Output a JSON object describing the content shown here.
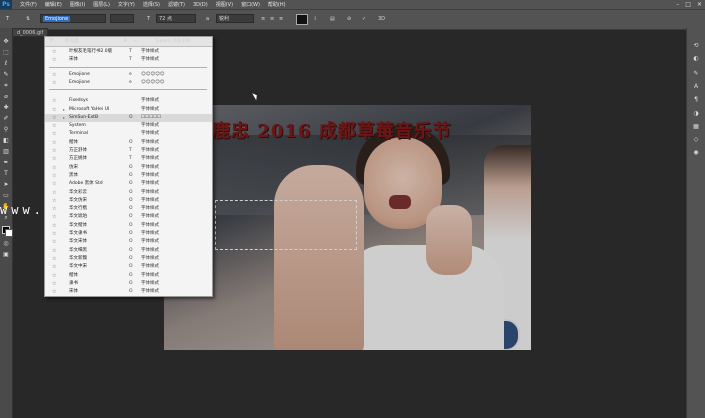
{
  "menubar": {
    "logo": "Ps",
    "items": [
      "文件(F)",
      "编辑(E)",
      "图像(I)",
      "图层(L)",
      "文字(Y)",
      "选择(S)",
      "滤镜(T)",
      "3D(D)",
      "视图(V)",
      "窗口(W)",
      "帮助(H)"
    ]
  },
  "options": {
    "font_family_value": "Emojione",
    "font_size_value": "72 点",
    "antialias_value": "锐利",
    "color_swatch": "#111111"
  },
  "document_tab": "d_0006.gif",
  "font_menu": {
    "filter_label": "所有类",
    "header_label": "Typekit 添加字体",
    "rows": [
      {
        "name": "叶根友毛笔行书2.0版",
        "type": "T",
        "sample": "字体样式"
      },
      {
        "name": "宋体",
        "type": "T",
        "sample": "字体样式"
      },
      {
        "name": "Emojione",
        "type": "e",
        "sample": "☺☺☺☺☺"
      },
      {
        "name": "Emojione",
        "type": "e",
        "sample": "☺☺☺☺☺"
      },
      {
        "name": "Fixedsys",
        "type": "",
        "sample": "字体样式"
      },
      {
        "name": "Microsoft YaHei UI",
        "type": "",
        "sample": "字体样式"
      },
      {
        "name": "SimSun-ExtB",
        "type": "O",
        "sample": "☐☐☐☐☐"
      },
      {
        "name": "System",
        "type": "",
        "sample": "字体样式"
      },
      {
        "name": "Terminal",
        "type": "",
        "sample": "字体样式"
      },
      {
        "name": "楷体",
        "type": "O",
        "sample": "字体样式"
      },
      {
        "name": "方正舒体",
        "type": "T",
        "sample": "字体样式"
      },
      {
        "name": "方正姚体",
        "type": "T",
        "sample": "字体样式"
      },
      {
        "name": "仿宋",
        "type": "O",
        "sample": "字体样式"
      },
      {
        "name": "黑体",
        "type": "O",
        "sample": "字体样式"
      },
      {
        "name": "Adobe 黑体 Std",
        "type": "O",
        "sample": "字体样式"
      },
      {
        "name": "华文彩云",
        "type": "O",
        "sample": "字体样式"
      },
      {
        "name": "华文仿宋",
        "type": "O",
        "sample": "字体样式"
      },
      {
        "name": "华文行楷",
        "type": "O",
        "sample": "字体样式"
      },
      {
        "name": "华文琥珀",
        "type": "O",
        "sample": "字体样式"
      },
      {
        "name": "华文楷体",
        "type": "O",
        "sample": "字体样式"
      },
      {
        "name": "华文隶书",
        "type": "O",
        "sample": "字体样式"
      },
      {
        "name": "华文宋体",
        "type": "O",
        "sample": "字体样式"
      },
      {
        "name": "华文细黑",
        "type": "O",
        "sample": "字体样式"
      },
      {
        "name": "华文新魏",
        "type": "O",
        "sample": "字体样式"
      },
      {
        "name": "华文中宋",
        "type": "O",
        "sample": "字体样式"
      },
      {
        "name": "楷体",
        "type": "O",
        "sample": "字体样式"
      },
      {
        "name": "隶书",
        "type": "O",
        "sample": "字体样式"
      },
      {
        "name": "宋体",
        "type": "O",
        "sample": "字体样式"
      },
      {
        "name": "微软雅黑",
        "type": "O",
        "sample": "字体样式"
      }
    ]
  },
  "canvas": {
    "photo_title": "鹿忠 2016 成都草莓音乐节",
    "watermark": "www.     jl.com"
  }
}
